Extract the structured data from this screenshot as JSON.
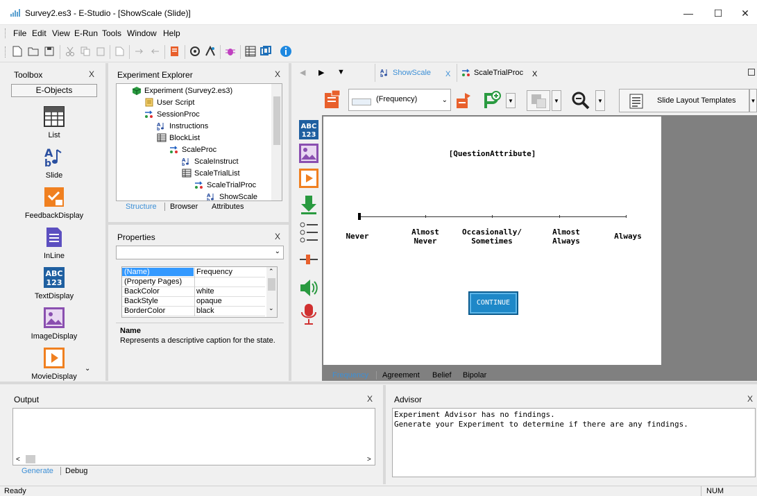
{
  "window": {
    "title": "Survey2.es3 - E-Studio - [ShowScale (Slide)]",
    "minimize": "—",
    "maximize": "☐",
    "close": "✕"
  },
  "menu": [
    "File",
    "Edit",
    "View",
    "E-Run",
    "Tools",
    "Window",
    "Help"
  ],
  "toolbox": {
    "title": "Toolbox",
    "close": "X",
    "header": "E-Objects",
    "items": [
      "List",
      "Slide",
      "FeedbackDisplay",
      "InLine",
      "TextDisplay",
      "ImageDisplay",
      "MovieDisplay"
    ]
  },
  "explorer": {
    "title": "Experiment Explorer",
    "close": "X",
    "tree": [
      "Experiment (Survey2.es3)",
      "User Script",
      "SessionProc",
      "Instructions",
      "BlockList",
      "ScaleProc",
      "ScaleInstruct",
      "ScaleTrialList",
      "ScaleTrialProc",
      "ShowScale"
    ],
    "tabs": [
      "Structure",
      "Browser",
      "Attributes"
    ]
  },
  "properties": {
    "title": "Properties",
    "close": "X",
    "rows": [
      {
        "key": "(Name)",
        "value": "Frequency"
      },
      {
        "key": "(Property Pages)",
        "value": ""
      },
      {
        "key": "BackColor",
        "value": "white"
      },
      {
        "key": "BackStyle",
        "value": "opaque"
      },
      {
        "key": "BorderColor",
        "value": "black"
      }
    ],
    "desc_title": "Name",
    "desc_text": "Represents a descriptive caption for the state."
  },
  "doc_tabs": [
    {
      "label": "ShowScale",
      "close": "X"
    },
    {
      "label": "ScaleTrialProc",
      "close": "X"
    }
  ],
  "slide_toolbar": {
    "state_combo": "(Frequency)",
    "layout_templates": "Slide Layout Templates"
  },
  "slide": {
    "question": "[QuestionAttribute]",
    "scale_labels": [
      "Never",
      "Almost\nNever",
      "Occasionally/\nSometimes",
      "Almost\nAlways",
      "Always"
    ],
    "continue": "CONTINUE"
  },
  "slide_tabs": [
    "Frequency",
    "Agreement",
    "Belief",
    "Bipolar"
  ],
  "output": {
    "title": "Output",
    "close": "X",
    "tabs": [
      "Generate",
      "Debug"
    ]
  },
  "advisor": {
    "title": "Advisor",
    "close": "X",
    "lines": [
      "Experiment Advisor has no findings.",
      "Generate your Experiment to determine if there are any findings."
    ]
  },
  "status": {
    "left": "Ready",
    "num": "NUM"
  },
  "colors": {
    "selection": "#3399ff",
    "accent_blue": "#1e88c8",
    "tab_active": "#3c8fd6"
  }
}
